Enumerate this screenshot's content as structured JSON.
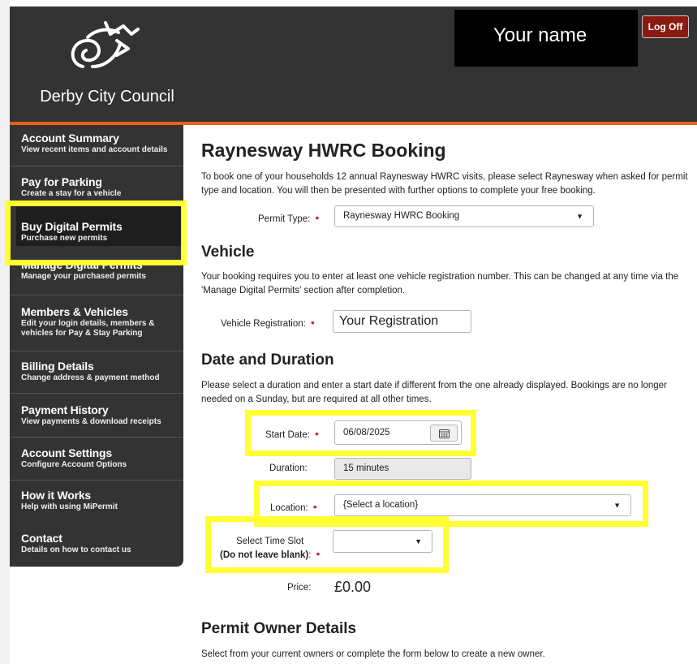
{
  "header": {
    "logo_text": "Derby City Council",
    "user_name": "Your name",
    "logoff_label": "Log Off"
  },
  "sidebar": {
    "items": [
      {
        "title": "Account Summary",
        "subtitle": "View recent items and account details"
      },
      {
        "title": "Pay for Parking",
        "subtitle": "Create a stay for a vehicle"
      },
      {
        "title": "Buy Digital Permits",
        "subtitle": "Purchase new permits"
      },
      {
        "title": "Manage Digital Permits",
        "subtitle": "Manage your purchased permits"
      },
      {
        "title": "Members & Vehicles",
        "subtitle": "Edit your login details, members & vehicles for Pay & Stay Parking"
      },
      {
        "title": "Billing Details",
        "subtitle": "Change address & payment method"
      },
      {
        "title": "Payment History",
        "subtitle": "View payments & download receipts"
      },
      {
        "title": "Account Settings",
        "subtitle": "Configure Account Options"
      },
      {
        "title": "How it Works",
        "subtitle": "Help with using MiPermit"
      },
      {
        "title": "Contact",
        "subtitle": "Details on how to contact us"
      }
    ]
  },
  "main": {
    "title": "Raynesway HWRC Booking",
    "intro": "To book one of your households 12 annual Raynesway HWRC visits, please select Raynesway when asked for permit type and location. You will then be presented with further options to complete your free booking.",
    "permit_type_label": "Permit Type:",
    "permit_type_value": "Raynesway HWRC Booking",
    "vehicle_heading": "Vehicle",
    "vehicle_text": "Your booking requires you to enter at least one vehicle registration number. This can be changed at any time via the 'Manage Digital Permits' section after completion.",
    "vehicle_reg_label": "Vehicle Registration:",
    "vehicle_reg_value": "Your Registration",
    "date_heading": "Date and Duration",
    "date_text": "Please select a duration and enter a start date if different from the one already displayed. Bookings are no longer needed on a Sunday, but are required at all other times.",
    "start_date_label": "Start Date:",
    "start_date_value": "06/08/2025",
    "duration_label": "Duration:",
    "duration_value": "15 minutes",
    "location_label": "Location:",
    "location_value": "{Select a location}",
    "time_slot_label": "Select Time Slot",
    "time_slot_note": "(Do not leave blank)",
    "time_slot_colon": ":",
    "time_slot_value": "",
    "price_label": "Price:",
    "price_value": "£0.00",
    "owner_heading": "Permit Owner Details",
    "owner_text": "Select from your current owners or complete the form below to create a new owner."
  },
  "colors": {
    "header_bg": "#333333",
    "accent_orange": "#e8611a",
    "logoff_bg": "#8b1a10",
    "highlight": "#ffff33",
    "required": "#e02020"
  }
}
